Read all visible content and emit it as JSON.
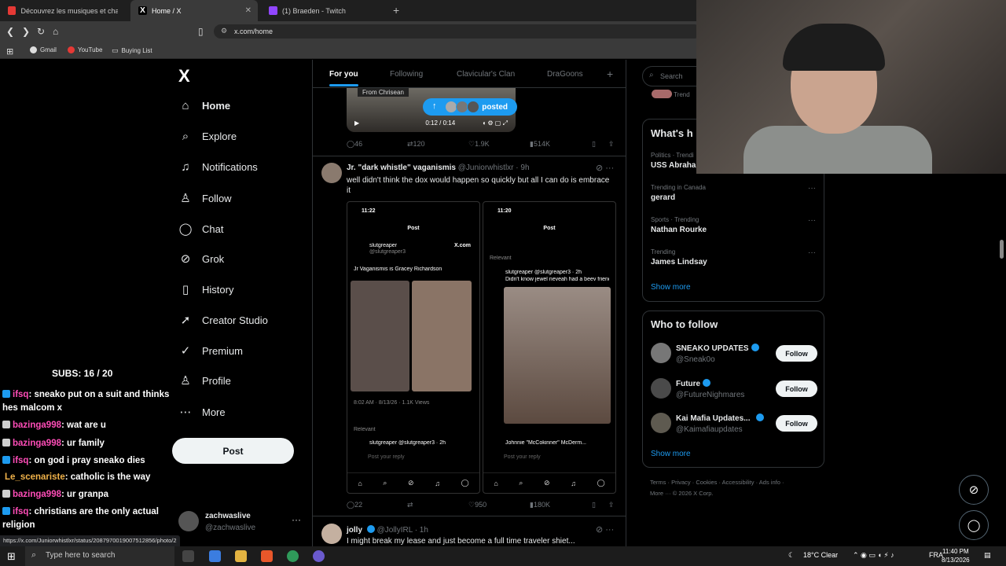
{
  "browser": {
    "tabs": [
      {
        "title": "Découvrez les musiques et chansons",
        "favicon_color": "#e53935"
      },
      {
        "title": "Home / X",
        "favicon_color": "#ffffff"
      },
      {
        "title": "(1) Braeden - Twitch",
        "favicon_color": "#9146ff"
      }
    ],
    "url": "x.com/home",
    "bookmarks": [
      "Gmail",
      "YouTube",
      "Buying List"
    ],
    "status_url": "https://x.com/Juniorwhistlxr/status/2087970019007512856/photo/2"
  },
  "sidebar": {
    "logo": "X",
    "items": [
      {
        "label": "Home",
        "icon": "home-icon",
        "glyph": "⌂"
      },
      {
        "label": "Explore",
        "icon": "search-icon",
        "glyph": "⌕"
      },
      {
        "label": "Notifications",
        "icon": "bell-icon",
        "glyph": "♫"
      },
      {
        "label": "Follow",
        "icon": "person-add-icon",
        "glyph": "♙"
      },
      {
        "label": "Chat",
        "icon": "chat-icon",
        "glyph": "◯"
      },
      {
        "label": "Grok",
        "icon": "grok-icon",
        "glyph": "⊘"
      },
      {
        "label": "History",
        "icon": "bookmark-icon",
        "glyph": "▯"
      },
      {
        "label": "Creator Studio",
        "icon": "rocket-icon",
        "glyph": "➚"
      },
      {
        "label": "Premium",
        "icon": "check-badge-icon",
        "glyph": "✓"
      },
      {
        "label": "Profile",
        "icon": "person-icon",
        "glyph": "♙"
      },
      {
        "label": "More",
        "icon": "more-circle-icon",
        "glyph": "⋯"
      }
    ],
    "post_button": "Post",
    "account": {
      "name": "zachwaslive",
      "handle": "@zachwaslive"
    }
  },
  "stream_overlay": {
    "subs": "SUBS: 16 / 20",
    "chat": [
      {
        "user": "ifsq",
        "color": "#ff4db8",
        "text": ": sneako put on a suit and thinks hes malcom x",
        "badge": "#1d9bf0"
      },
      {
        "user": "bazinga998",
        "color": "#ff4db8",
        "text": ": wat are u",
        "badge": "#cfcfcf"
      },
      {
        "user": "bazinga998",
        "color": "#ff4db8",
        "text": ": ur family",
        "badge": "#cfcfcf"
      },
      {
        "user": "ifsq",
        "color": "#ff4db8",
        "text": ": on god i pray sneako dies",
        "badge": "#1d9bf0"
      },
      {
        "user": "Le_scenariste",
        "color": "#f0b24a",
        "text": ": catholic is the way",
        "badge": ""
      },
      {
        "user": "bazinga998",
        "color": "#ff4db8",
        "text": ": ur granpa",
        "badge": "#cfcfcf"
      },
      {
        "user": "ifsq",
        "color": "#ff4db8",
        "text": ": christians are the only actual religion",
        "badge": "#1d9bf0"
      }
    ]
  },
  "timeline": {
    "tabs": [
      "For you",
      "Following",
      "Clavicular's Clan",
      "DraGoons",
      "+"
    ],
    "post0": {
      "from_label": "From Chrisean",
      "time": "0:12 / 0:14",
      "posted_pill": "posted",
      "replies": "46",
      "reposts": "120",
      "likes": "1.9K",
      "views": "514K"
    },
    "post1": {
      "name": "Jr. \"dark whistle\" vaganismis",
      "handle": "@Juniorwhistlxr · 9h",
      "text": "well didn't think the dox would happen so quickly but all I can do is embrace it",
      "replies": "22",
      "likes": "950",
      "views": "180K",
      "shot_left": {
        "time": "11:22",
        "title": "Post",
        "user": "slutgreaper",
        "handle": "@slutgreaper3",
        "brand": "X.com",
        "caption": "Jr Vaganismis is Gracey Richardson",
        "meta": "8:02 AM · 8/13/26 · 1.1K Views",
        "relevant": "Relevant",
        "reply_user": "slutgreaper @slutgreaper3 · 2h",
        "reply_placeholder": "Post your reply"
      },
      "shot_right": {
        "time": "11:20",
        "title": "Post",
        "relevant": "Relevant",
        "user": "slutgreaper @slutgreaper3 · 2h",
        "caption": "Didn't know jewel neveah had a beev friend!",
        "reply_user": "Johnnie \"McCokinner\" McDerm...",
        "reply_placeholder": "Post your reply"
      }
    },
    "post2": {
      "name": "jolly",
      "handle": "@JollyIRL · 1h",
      "text": "I might break my lease and just become a full time traveler shiet..."
    }
  },
  "right": {
    "search_placeholder": "Search",
    "trending_stub": "Trend",
    "whats_happening": "What's h",
    "trends": [
      {
        "meta": "Politics · Trendi",
        "name": "USS Abrahar"
      },
      {
        "meta": "Trending in Canada",
        "name": "gerard"
      },
      {
        "meta": "Sports · Trending",
        "name": "Nathan Rourke"
      },
      {
        "meta": "Trending",
        "name": "James Lindsay"
      }
    ],
    "show_more": "Show more",
    "who_to_follow": "Who to follow",
    "follow_suggestions": [
      {
        "name": "SNEAKO UPDATES",
        "handle": "@Sneak0o",
        "button": "Follow"
      },
      {
        "name": "Future",
        "handle": "@FutureNighmares",
        "button": "Follow"
      },
      {
        "name": "Kai Mafia Updates...",
        "handle": "@Kaimafiaupdates",
        "button": "Follow"
      }
    ],
    "footer_line1": "Terms  ·  Privacy  ·  Cookies  ·  Accessibility  ·  Ads info  ·",
    "footer_line2": "More ···  © 2026 X Corp."
  },
  "taskbar": {
    "search_placeholder": "Type here to search",
    "weather": "18°C  Clear",
    "language": "FRA",
    "time": "11:40 PM",
    "date": "8/13/2026"
  },
  "colors": {
    "accent": "#1d9bf0",
    "bg": "#000000",
    "border": "#2f3336"
  }
}
